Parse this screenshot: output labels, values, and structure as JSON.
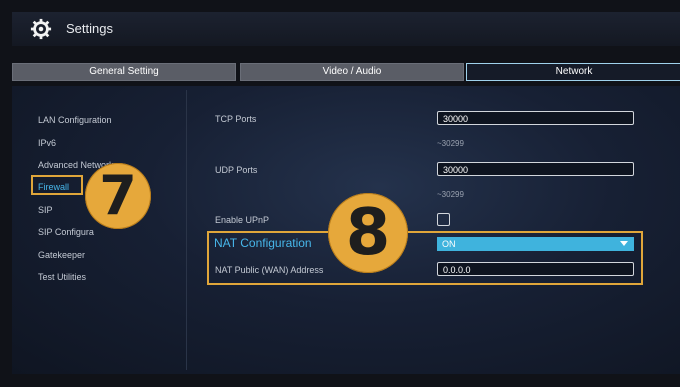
{
  "app": {
    "title": "Settings"
  },
  "tabs": [
    {
      "label": "General Setting"
    },
    {
      "label": "Video / Audio"
    },
    {
      "label": "Network"
    }
  ],
  "sidebar": {
    "items": [
      {
        "label": "LAN Configuration"
      },
      {
        "label": "IPv6"
      },
      {
        "label": "Advanced Network"
      },
      {
        "label": "Firewall"
      },
      {
        "label": "SIP"
      },
      {
        "label": "SIP Configura"
      },
      {
        "label": "Gatekeeper"
      },
      {
        "label": "Test Utilities"
      }
    ]
  },
  "firewall": {
    "tcp_label": "TCP Ports",
    "tcp_value": "30000",
    "tcp_range": "~30299",
    "udp_label": "UDP Ports",
    "udp_value": "30000",
    "udp_range": "~30299",
    "upnp_label": "Enable UPnP",
    "upnp_checked": false,
    "nat_label": "NAT Configuration",
    "nat_value": "ON",
    "nat_public_label": "NAT Public (WAN) Address",
    "nat_public_value": "0.0.0.0"
  },
  "badges": {
    "step7": "7",
    "step8": "8"
  },
  "colors": {
    "accent_blue": "#47b6ea",
    "select_blue": "#3fb3dd",
    "callout_orange": "#e6a83b",
    "background": "#101218"
  }
}
